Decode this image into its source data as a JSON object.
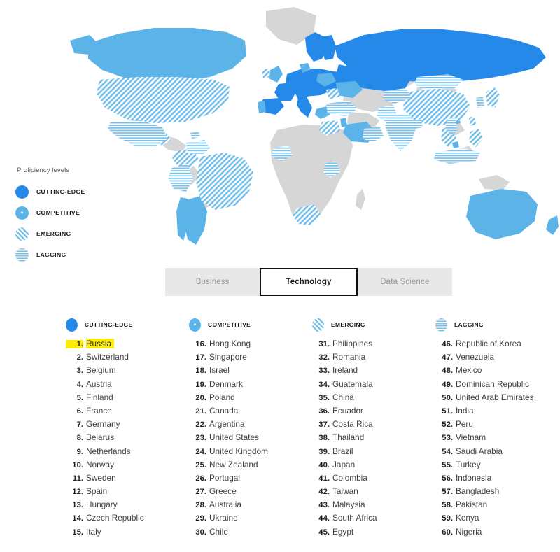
{
  "legend": {
    "title": "Proficiency levels",
    "items": [
      {
        "label": "CUTTING-EDGE",
        "icon": "solid-circle-icon",
        "color": "#2489e8"
      },
      {
        "label": "COMPETITIVE",
        "icon": "dotted-circle-icon",
        "color": "#5cb3e8"
      },
      {
        "label": "EMERGING",
        "icon": "diagonal-stripe-circle-icon",
        "color": "#6cbcec"
      },
      {
        "label": "LAGGING",
        "icon": "horizontal-stripe-circle-icon",
        "color": "#74c1ee"
      }
    ]
  },
  "tabs": [
    {
      "label": "Business",
      "active": false
    },
    {
      "label": "Technology",
      "active": true
    },
    {
      "label": "Data Science",
      "active": false
    }
  ],
  "columns": [
    {
      "title": "CUTTING-EDGE",
      "swatch": "solid-circle-icon",
      "entries": [
        {
          "rank": "1.",
          "name": "Russia",
          "highlighted": true
        },
        {
          "rank": "2.",
          "name": "Switzerland",
          "highlighted": false
        },
        {
          "rank": "3.",
          "name": "Belgium",
          "highlighted": false
        },
        {
          "rank": "4.",
          "name": "Austria",
          "highlighted": false
        },
        {
          "rank": "5.",
          "name": "Finland",
          "highlighted": false
        },
        {
          "rank": "6.",
          "name": "France",
          "highlighted": false
        },
        {
          "rank": "7.",
          "name": "Germany",
          "highlighted": false
        },
        {
          "rank": "8.",
          "name": "Belarus",
          "highlighted": false
        },
        {
          "rank": "9.",
          "name": "Netherlands",
          "highlighted": false
        },
        {
          "rank": "10.",
          "name": "Norway",
          "highlighted": false
        },
        {
          "rank": "11.",
          "name": "Sweden",
          "highlighted": false
        },
        {
          "rank": "12.",
          "name": "Spain",
          "highlighted": false
        },
        {
          "rank": "13.",
          "name": "Hungary",
          "highlighted": false
        },
        {
          "rank": "14.",
          "name": "Czech Republic",
          "highlighted": false
        },
        {
          "rank": "15.",
          "name": "Italy",
          "highlighted": false
        }
      ]
    },
    {
      "title": "COMPETITIVE",
      "swatch": "dotted-circle-icon",
      "entries": [
        {
          "rank": "16.",
          "name": "Hong Kong",
          "highlighted": false
        },
        {
          "rank": "17.",
          "name": "Singapore",
          "highlighted": false
        },
        {
          "rank": "18.",
          "name": "Israel",
          "highlighted": false
        },
        {
          "rank": "19.",
          "name": "Denmark",
          "highlighted": false
        },
        {
          "rank": "20.",
          "name": "Poland",
          "highlighted": false
        },
        {
          "rank": "21.",
          "name": "Canada",
          "highlighted": false
        },
        {
          "rank": "22.",
          "name": "Argentina",
          "highlighted": false
        },
        {
          "rank": "23.",
          "name": "United States",
          "highlighted": false
        },
        {
          "rank": "24.",
          "name": "United Kingdom",
          "highlighted": false
        },
        {
          "rank": "25.",
          "name": "New Zealand",
          "highlighted": false
        },
        {
          "rank": "26.",
          "name": "Portugal",
          "highlighted": false
        },
        {
          "rank": "27.",
          "name": "Greece",
          "highlighted": false
        },
        {
          "rank": "28.",
          "name": "Australia",
          "highlighted": false
        },
        {
          "rank": "29.",
          "name": "Ukraine",
          "highlighted": false
        },
        {
          "rank": "30.",
          "name": "Chile",
          "highlighted": false
        }
      ]
    },
    {
      "title": "EMERGING",
      "swatch": "diagonal-stripe-circle-icon",
      "entries": [
        {
          "rank": "31.",
          "name": "Philippines",
          "highlighted": false
        },
        {
          "rank": "32.",
          "name": "Romania",
          "highlighted": false
        },
        {
          "rank": "33.",
          "name": "Ireland",
          "highlighted": false
        },
        {
          "rank": "34.",
          "name": "Guatemala",
          "highlighted": false
        },
        {
          "rank": "35.",
          "name": "China",
          "highlighted": false
        },
        {
          "rank": "36.",
          "name": "Ecuador",
          "highlighted": false
        },
        {
          "rank": "37.",
          "name": "Costa Rica",
          "highlighted": false
        },
        {
          "rank": "38.",
          "name": "Thailand",
          "highlighted": false
        },
        {
          "rank": "39.",
          "name": "Brazil",
          "highlighted": false
        },
        {
          "rank": "40.",
          "name": "Japan",
          "highlighted": false
        },
        {
          "rank": "41.",
          "name": "Colombia",
          "highlighted": false
        },
        {
          "rank": "42.",
          "name": "Taiwan",
          "highlighted": false
        },
        {
          "rank": "43.",
          "name": "Malaysia",
          "highlighted": false
        },
        {
          "rank": "44.",
          "name": "South Africa",
          "highlighted": false
        },
        {
          "rank": "45.",
          "name": "Egypt",
          "highlighted": false
        }
      ]
    },
    {
      "title": "LAGGING",
      "swatch": "horizontal-stripe-circle-icon",
      "entries": [
        {
          "rank": "46.",
          "name": "Republic of Korea",
          "highlighted": false
        },
        {
          "rank": "47.",
          "name": "Venezuela",
          "highlighted": false
        },
        {
          "rank": "48.",
          "name": "Mexico",
          "highlighted": false
        },
        {
          "rank": "49.",
          "name": "Dominican Republic",
          "highlighted": false
        },
        {
          "rank": "50.",
          "name": "United Arab Emirates",
          "highlighted": false
        },
        {
          "rank": "51.",
          "name": "India",
          "highlighted": false
        },
        {
          "rank": "52.",
          "name": "Peru",
          "highlighted": false
        },
        {
          "rank": "53.",
          "name": "Vietnam",
          "highlighted": false
        },
        {
          "rank": "54.",
          "name": "Saudi Arabia",
          "highlighted": false
        },
        {
          "rank": "55.",
          "name": "Turkey",
          "highlighted": false
        },
        {
          "rank": "56.",
          "name": "Indonesia",
          "highlighted": false
        },
        {
          "rank": "57.",
          "name": "Bangladesh",
          "highlighted": false
        },
        {
          "rank": "58.",
          "name": "Pakistan",
          "highlighted": false
        },
        {
          "rank": "59.",
          "name": "Kenya",
          "highlighted": false
        },
        {
          "rank": "60.",
          "name": "Nigeria",
          "highlighted": false
        }
      ]
    }
  ],
  "map": {
    "no_data_color": "#d6d6d6",
    "cutting_edge_color": "#2489e8",
    "competitive_color": "#5cb3e8",
    "emerging_color": "#6cbcec",
    "lagging_color": "#74c1ee"
  }
}
